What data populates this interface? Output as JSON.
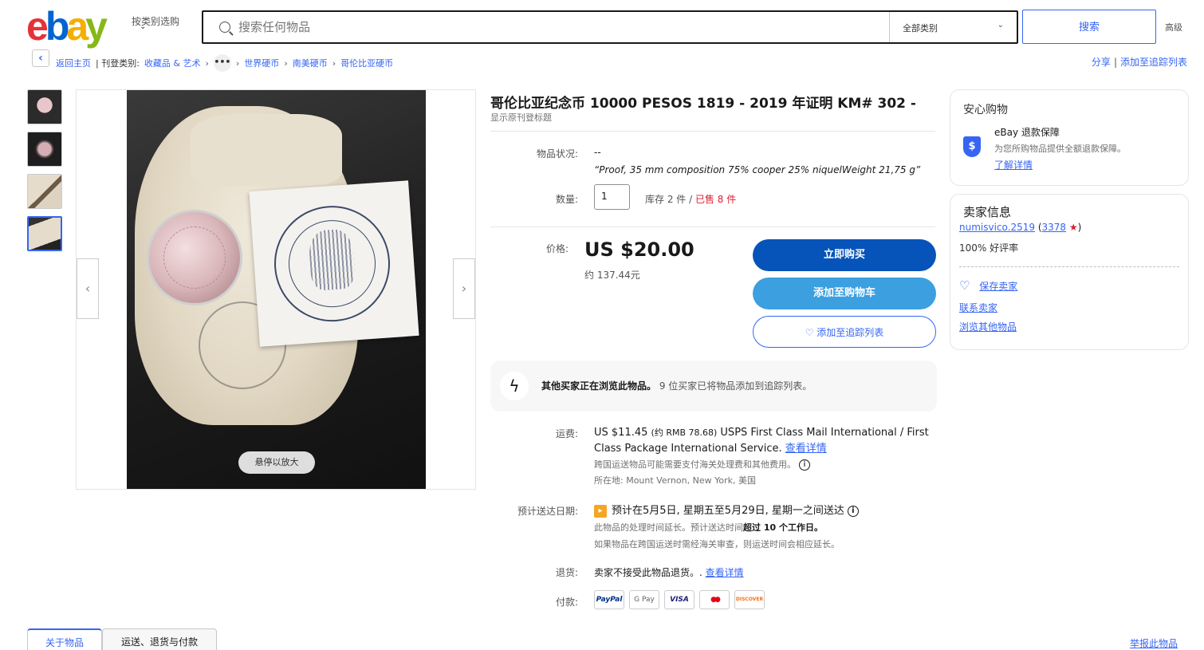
{
  "header": {
    "logo": {
      "e": "e",
      "b": "b",
      "a": "a",
      "y": "y"
    },
    "shop_by": "按类别选购",
    "search_placeholder": "搜索任何物品",
    "category_select": "全部类别",
    "search_button": "搜索",
    "advanced": "高级"
  },
  "breadcrumb": {
    "back_home": "返回主页",
    "listed_in": "| 刊登类别:",
    "items": [
      "收藏品 & 艺术",
      "世界硬币",
      "南美硬币",
      "哥伦比亚硬币"
    ],
    "more": "•••"
  },
  "actions": {
    "share": "分享",
    "sep": "|",
    "watch": "添加至追踪列表"
  },
  "gallery": {
    "hover_zoom": "悬停以放大",
    "prev": "‹",
    "next": "›"
  },
  "item": {
    "title": "哥伦比亚纪念币 10000 PESOS 1819 - 2019 年证明 KM# 302 -",
    "original_title": "显示原刊登标题",
    "condition_label": "物品状况:",
    "condition_value": "--",
    "condition_quote": "“Proof, 35 mm composition 75% cooper 25% niquelWeight 21,75 g”",
    "quantity_label": "数量:",
    "quantity_value": "1",
    "stock_text": "库存 2 件 /",
    "sold_text": "已售 8 件",
    "price_label": "价格:",
    "price": "US $20.00",
    "price_cny": "约 137.44元",
    "buy_now": "立即购买",
    "add_to_cart": "添加至购物车",
    "add_to_watch": "♡ 添加至追踪列表"
  },
  "activity": {
    "bold": "其他买家正在浏览此物品。",
    "rest": "9 位买家已将物品添加到追踪列表。"
  },
  "shipping": {
    "label": "运费:",
    "cost": "US $11.45",
    "cost_cny": "(约 RMB 78.68)",
    "service": "USPS First Class Mail International / First Class Package International Service.",
    "details": "查看详情",
    "customs_note": "跨国运送物品可能需要支付海关处理费和其他费用。",
    "location": "所在地:  Mount Vernon, New York, 美国"
  },
  "delivery": {
    "label": "预计送达日期:",
    "estimate": "预计在5月5日, 星期五至5月29日, 星期一之间送达",
    "note1_pre": "此物品的处理时间延长。预计送达时间",
    "note1_bold": "超过 10 个工作日。",
    "note2": "如果物品在跨国运送时需经海关审查，则运送时间会相应延长。"
  },
  "returns": {
    "label": "退货:",
    "text": "卖家不接受此物品退货。.",
    "link": "查看详情"
  },
  "payments": {
    "label": "付款:",
    "methods": [
      "PayPal",
      "G Pay",
      "VISA",
      "●●",
      "DISCOVER"
    ]
  },
  "protection": {
    "title": "安心购物",
    "heading": "eBay 退款保障",
    "desc": "为您所购物品提供全额退款保障。",
    "link": "了解详情"
  },
  "seller": {
    "title": "卖家信息",
    "name": "numisvico.2519",
    "score": "3378",
    "positive": "100% 好评率",
    "save": "保存卖家",
    "contact": "联系卖家",
    "other_items": "浏览其他物品"
  },
  "tabs": {
    "about": "关于物品",
    "shipping": "运送、退货与付款"
  },
  "report": "举报此物品",
  "colors": {
    "accent": "#3665f3",
    "buy": "#0654ba",
    "cart": "#3b9fe0",
    "sold": "#dd1e31"
  }
}
